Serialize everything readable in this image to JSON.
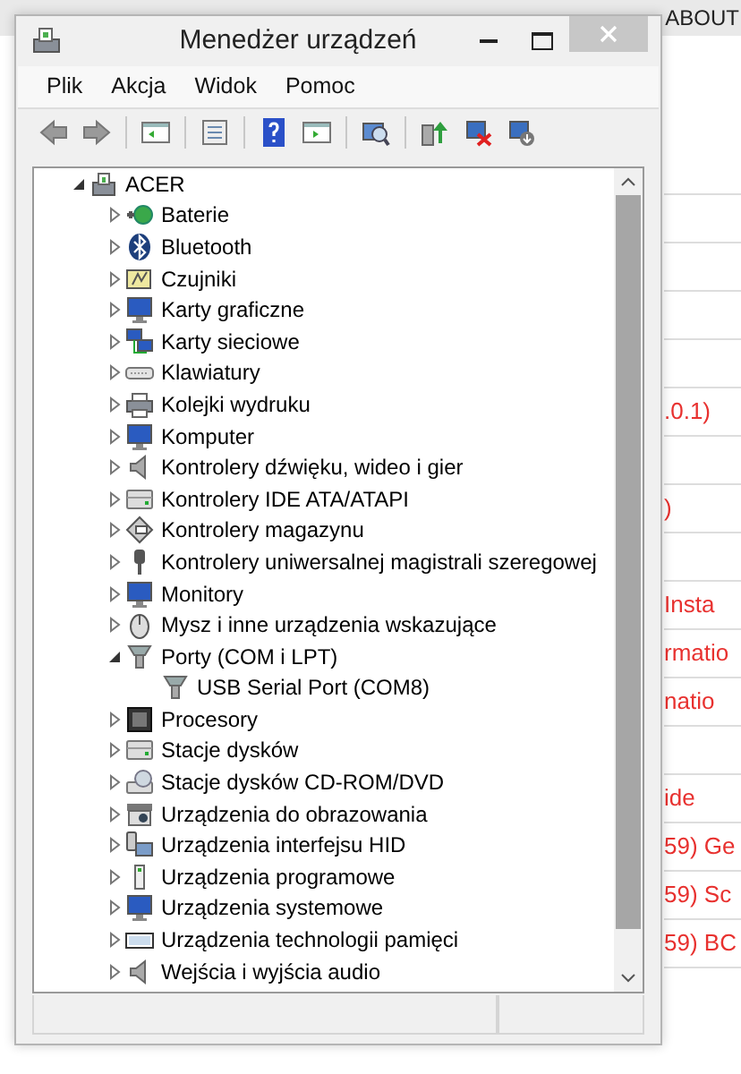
{
  "background": {
    "tab_text": "ABOUT",
    "rows": [
      {},
      {},
      {},
      {},
      {
        "text": ".0.1)"
      },
      {},
      {
        "text": ")"
      },
      {},
      {
        "text": "Insta"
      },
      {
        "text": "rmatio"
      },
      {
        "text": "natio"
      },
      {},
      {
        "text": "ide"
      },
      {
        "text": "59) Ge"
      },
      {
        "text": "59) Sc"
      },
      {
        "text": "59) BC"
      }
    ]
  },
  "window": {
    "title": "Menedżer urządzeń"
  },
  "menu": [
    "Plik",
    "Akcja",
    "Widok",
    "Pomoc"
  ],
  "tree": {
    "label": "ACER",
    "expanded": true,
    "children": [
      {
        "label": "Baterie",
        "expanded": false
      },
      {
        "label": "Bluetooth",
        "expanded": false
      },
      {
        "label": "Czujniki",
        "expanded": false
      },
      {
        "label": "Karty graficzne",
        "expanded": false
      },
      {
        "label": "Karty sieciowe",
        "expanded": false
      },
      {
        "label": "Klawiatury",
        "expanded": false
      },
      {
        "label": "Kolejki wydruku",
        "expanded": false
      },
      {
        "label": "Komputer",
        "expanded": false
      },
      {
        "label": "Kontrolery dźwięku, wideo i gier",
        "expanded": false
      },
      {
        "label": "Kontrolery IDE ATA/ATAPI",
        "expanded": false
      },
      {
        "label": "Kontrolery magazynu",
        "expanded": false
      },
      {
        "label": "Kontrolery uniwersalnej magistrali szeregowej",
        "expanded": false
      },
      {
        "label": "Monitory",
        "expanded": false
      },
      {
        "label": "Mysz i inne urządzenia wskazujące",
        "expanded": false
      },
      {
        "label": "Porty (COM i LPT)",
        "expanded": true,
        "children": [
          {
            "label": "USB Serial Port (COM8)"
          }
        ]
      },
      {
        "label": "Procesory",
        "expanded": false
      },
      {
        "label": "Stacje dysków",
        "expanded": false
      },
      {
        "label": "Stacje dysków CD-ROM/DVD",
        "expanded": false
      },
      {
        "label": "Urządzenia do obrazowania",
        "expanded": false
      },
      {
        "label": "Urządzenia interfejsu HID",
        "expanded": false
      },
      {
        "label": "Urządzenia programowe",
        "expanded": false
      },
      {
        "label": "Urządzenia systemowe",
        "expanded": false
      },
      {
        "label": "Urządzenia technologii pamięci",
        "expanded": false
      },
      {
        "label": "Wejścia i wyjścia audio",
        "expanded": false
      }
    ]
  }
}
